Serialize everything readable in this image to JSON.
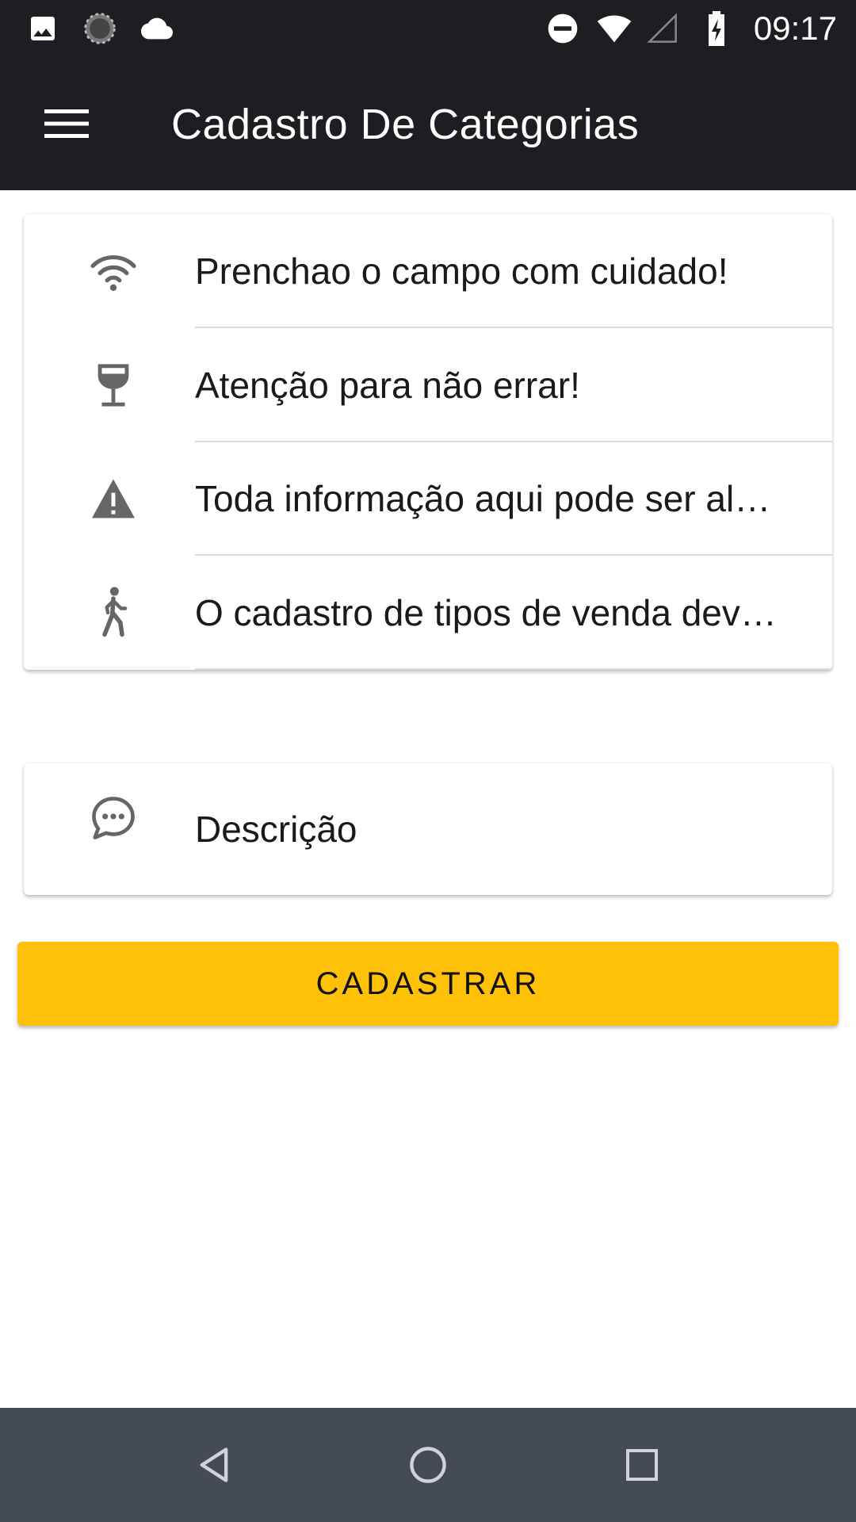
{
  "status_bar": {
    "time": "09:17",
    "icons": [
      "image-icon",
      "sync-icon",
      "cloud-icon",
      "do-not-disturb-icon",
      "wifi-icon",
      "cell-signal-icon",
      "battery-charging-icon"
    ]
  },
  "app_bar": {
    "title": "Cadastro De Categorias",
    "menu_icon": "menu-icon"
  },
  "info_list": [
    {
      "icon": "wifi-icon",
      "text": "Prenchao o campo com cuidado!"
    },
    {
      "icon": "wine-glass-icon",
      "text": "Atenção para não errar!"
    },
    {
      "icon": "warning-icon",
      "text": "Toda informação aqui pode ser al…"
    },
    {
      "icon": "walking-person-icon",
      "text": "O cadastro de tipos de venda dev…"
    }
  ],
  "form": {
    "description_placeholder": "Descrição",
    "description_icon": "chat-bubble-icon"
  },
  "submit_label": "CADASTRAR",
  "colors": {
    "app_bar": "#1d1e22",
    "accent_button": "#fec107",
    "nav_bar": "#454b52",
    "icon_gray": "#666666"
  },
  "nav_bar": {
    "buttons": [
      "back-icon",
      "home-icon",
      "recents-icon"
    ]
  }
}
